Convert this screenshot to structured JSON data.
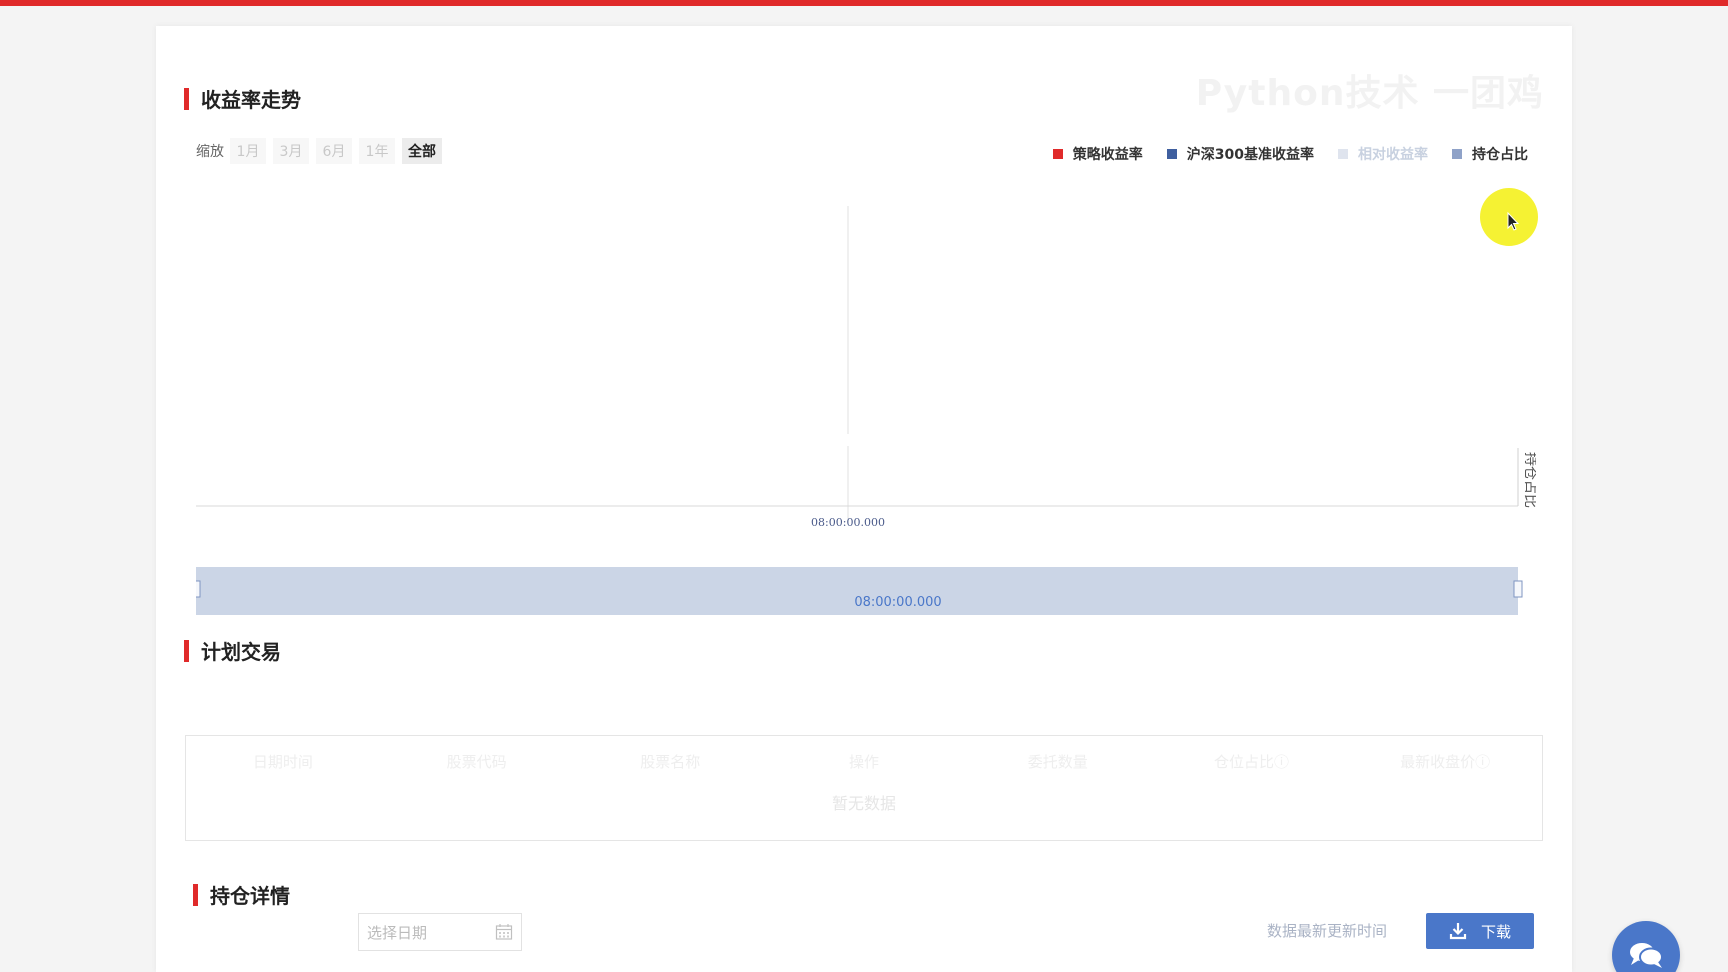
{
  "watermark": "Python技术 一团鸡",
  "sections": {
    "returns_title": "收益率走势",
    "plan_title": "计划交易",
    "holdings_title": "持仓详情"
  },
  "zoom": {
    "label": "缩放",
    "options": [
      "1月",
      "3月",
      "6月",
      "1年",
      "全部"
    ],
    "selected": "全部"
  },
  "legend": [
    {
      "label": "策略收益率",
      "color": "#e02a2a",
      "active": true
    },
    {
      "label": "沪深300基准收益率",
      "color": "#3f5f9f",
      "active": true
    },
    {
      "label": "相对收益率",
      "color": "#c8d1e0",
      "active": false
    },
    {
      "label": "持仓占比",
      "color": "#8fa2c8",
      "active": true
    }
  ],
  "chart_data": {
    "type": "line",
    "x": [
      "08:00:00.000"
    ],
    "series": [],
    "ylabel_right": "持仓占比",
    "navigator_label": "08:00:00.000"
  },
  "table": {
    "columns": [
      "日期时间",
      "股票代码",
      "股票名称",
      "操作",
      "委托数量",
      "仓位占比ⓘ",
      "最新收盘价ⓘ"
    ],
    "empty_text": "暂无数据"
  },
  "holdings": {
    "date_placeholder": "选择日期",
    "update_label": "数据最新更新时间",
    "download_label": "下载"
  },
  "colors": {
    "accent_red": "#e02a2a",
    "accent_blue": "#4a77c9",
    "cursor_highlight": "#f5f233"
  }
}
